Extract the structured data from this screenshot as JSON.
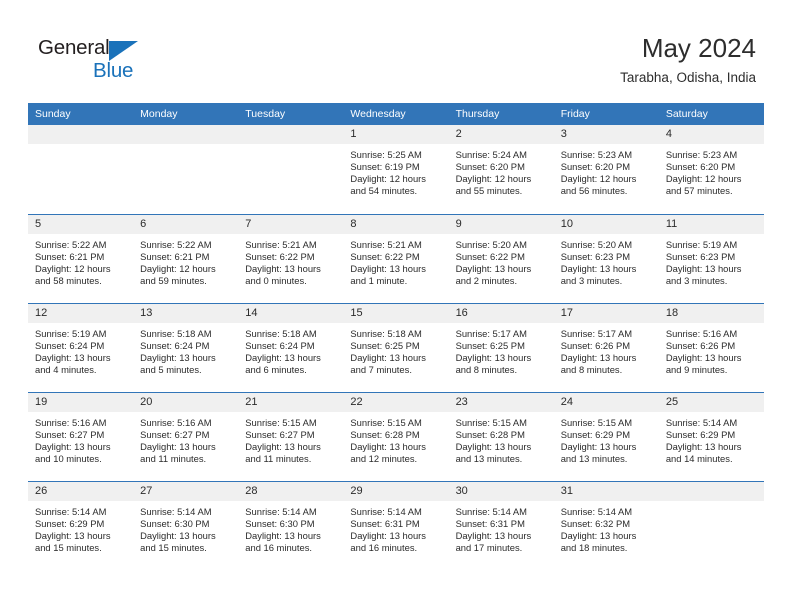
{
  "logo": {
    "text_general": "General",
    "text_blue": "Blue",
    "triangle_color": "#1a72ba"
  },
  "header": {
    "title": "May 2024",
    "subtitle": "Tarabha, Odisha, India"
  },
  "theme": {
    "header_blue": "#3275b8",
    "daynum_bg": "#f0f0f0",
    "text": "#2b2b2b"
  },
  "weekday_headers": [
    "Sunday",
    "Monday",
    "Tuesday",
    "Wednesday",
    "Thursday",
    "Friday",
    "Saturday"
  ],
  "labels": {
    "sunrise_prefix": "Sunrise: ",
    "sunset_prefix": "Sunset: ",
    "daylight_prefix": "Daylight: "
  },
  "weeks": [
    [
      {
        "day": "",
        "empty": true,
        "sunrise": "",
        "sunset": "",
        "daylight_line1": "",
        "daylight_line2": ""
      },
      {
        "day": "",
        "empty": true,
        "sunrise": "",
        "sunset": "",
        "daylight_line1": "",
        "daylight_line2": ""
      },
      {
        "day": "",
        "empty": true,
        "sunrise": "",
        "sunset": "",
        "daylight_line1": "",
        "daylight_line2": ""
      },
      {
        "day": "1",
        "empty": false,
        "sunrise": "Sunrise: 5:25 AM",
        "sunset": "Sunset: 6:19 PM",
        "daylight_line1": "Daylight: 12 hours",
        "daylight_line2": "and 54 minutes."
      },
      {
        "day": "2",
        "empty": false,
        "sunrise": "Sunrise: 5:24 AM",
        "sunset": "Sunset: 6:20 PM",
        "daylight_line1": "Daylight: 12 hours",
        "daylight_line2": "and 55 minutes."
      },
      {
        "day": "3",
        "empty": false,
        "sunrise": "Sunrise: 5:23 AM",
        "sunset": "Sunset: 6:20 PM",
        "daylight_line1": "Daylight: 12 hours",
        "daylight_line2": "and 56 minutes."
      },
      {
        "day": "4",
        "empty": false,
        "sunrise": "Sunrise: 5:23 AM",
        "sunset": "Sunset: 6:20 PM",
        "daylight_line1": "Daylight: 12 hours",
        "daylight_line2": "and 57 minutes."
      }
    ],
    [
      {
        "day": "5",
        "empty": false,
        "sunrise": "Sunrise: 5:22 AM",
        "sunset": "Sunset: 6:21 PM",
        "daylight_line1": "Daylight: 12 hours",
        "daylight_line2": "and 58 minutes."
      },
      {
        "day": "6",
        "empty": false,
        "sunrise": "Sunrise: 5:22 AM",
        "sunset": "Sunset: 6:21 PM",
        "daylight_line1": "Daylight: 12 hours",
        "daylight_line2": "and 59 minutes."
      },
      {
        "day": "7",
        "empty": false,
        "sunrise": "Sunrise: 5:21 AM",
        "sunset": "Sunset: 6:22 PM",
        "daylight_line1": "Daylight: 13 hours",
        "daylight_line2": "and 0 minutes."
      },
      {
        "day": "8",
        "empty": false,
        "sunrise": "Sunrise: 5:21 AM",
        "sunset": "Sunset: 6:22 PM",
        "daylight_line1": "Daylight: 13 hours",
        "daylight_line2": "and 1 minute."
      },
      {
        "day": "9",
        "empty": false,
        "sunrise": "Sunrise: 5:20 AM",
        "sunset": "Sunset: 6:22 PM",
        "daylight_line1": "Daylight: 13 hours",
        "daylight_line2": "and 2 minutes."
      },
      {
        "day": "10",
        "empty": false,
        "sunrise": "Sunrise: 5:20 AM",
        "sunset": "Sunset: 6:23 PM",
        "daylight_line1": "Daylight: 13 hours",
        "daylight_line2": "and 3 minutes."
      },
      {
        "day": "11",
        "empty": false,
        "sunrise": "Sunrise: 5:19 AM",
        "sunset": "Sunset: 6:23 PM",
        "daylight_line1": "Daylight: 13 hours",
        "daylight_line2": "and 3 minutes."
      }
    ],
    [
      {
        "day": "12",
        "empty": false,
        "sunrise": "Sunrise: 5:19 AM",
        "sunset": "Sunset: 6:24 PM",
        "daylight_line1": "Daylight: 13 hours",
        "daylight_line2": "and 4 minutes."
      },
      {
        "day": "13",
        "empty": false,
        "sunrise": "Sunrise: 5:18 AM",
        "sunset": "Sunset: 6:24 PM",
        "daylight_line1": "Daylight: 13 hours",
        "daylight_line2": "and 5 minutes."
      },
      {
        "day": "14",
        "empty": false,
        "sunrise": "Sunrise: 5:18 AM",
        "sunset": "Sunset: 6:24 PM",
        "daylight_line1": "Daylight: 13 hours",
        "daylight_line2": "and 6 minutes."
      },
      {
        "day": "15",
        "empty": false,
        "sunrise": "Sunrise: 5:18 AM",
        "sunset": "Sunset: 6:25 PM",
        "daylight_line1": "Daylight: 13 hours",
        "daylight_line2": "and 7 minutes."
      },
      {
        "day": "16",
        "empty": false,
        "sunrise": "Sunrise: 5:17 AM",
        "sunset": "Sunset: 6:25 PM",
        "daylight_line1": "Daylight: 13 hours",
        "daylight_line2": "and 8 minutes."
      },
      {
        "day": "17",
        "empty": false,
        "sunrise": "Sunrise: 5:17 AM",
        "sunset": "Sunset: 6:26 PM",
        "daylight_line1": "Daylight: 13 hours",
        "daylight_line2": "and 8 minutes."
      },
      {
        "day": "18",
        "empty": false,
        "sunrise": "Sunrise: 5:16 AM",
        "sunset": "Sunset: 6:26 PM",
        "daylight_line1": "Daylight: 13 hours",
        "daylight_line2": "and 9 minutes."
      }
    ],
    [
      {
        "day": "19",
        "empty": false,
        "sunrise": "Sunrise: 5:16 AM",
        "sunset": "Sunset: 6:27 PM",
        "daylight_line1": "Daylight: 13 hours",
        "daylight_line2": "and 10 minutes."
      },
      {
        "day": "20",
        "empty": false,
        "sunrise": "Sunrise: 5:16 AM",
        "sunset": "Sunset: 6:27 PM",
        "daylight_line1": "Daylight: 13 hours",
        "daylight_line2": "and 11 minutes."
      },
      {
        "day": "21",
        "empty": false,
        "sunrise": "Sunrise: 5:15 AM",
        "sunset": "Sunset: 6:27 PM",
        "daylight_line1": "Daylight: 13 hours",
        "daylight_line2": "and 11 minutes."
      },
      {
        "day": "22",
        "empty": false,
        "sunrise": "Sunrise: 5:15 AM",
        "sunset": "Sunset: 6:28 PM",
        "daylight_line1": "Daylight: 13 hours",
        "daylight_line2": "and 12 minutes."
      },
      {
        "day": "23",
        "empty": false,
        "sunrise": "Sunrise: 5:15 AM",
        "sunset": "Sunset: 6:28 PM",
        "daylight_line1": "Daylight: 13 hours",
        "daylight_line2": "and 13 minutes."
      },
      {
        "day": "24",
        "empty": false,
        "sunrise": "Sunrise: 5:15 AM",
        "sunset": "Sunset: 6:29 PM",
        "daylight_line1": "Daylight: 13 hours",
        "daylight_line2": "and 13 minutes."
      },
      {
        "day": "25",
        "empty": false,
        "sunrise": "Sunrise: 5:14 AM",
        "sunset": "Sunset: 6:29 PM",
        "daylight_line1": "Daylight: 13 hours",
        "daylight_line2": "and 14 minutes."
      }
    ],
    [
      {
        "day": "26",
        "empty": false,
        "sunrise": "Sunrise: 5:14 AM",
        "sunset": "Sunset: 6:29 PM",
        "daylight_line1": "Daylight: 13 hours",
        "daylight_line2": "and 15 minutes."
      },
      {
        "day": "27",
        "empty": false,
        "sunrise": "Sunrise: 5:14 AM",
        "sunset": "Sunset: 6:30 PM",
        "daylight_line1": "Daylight: 13 hours",
        "daylight_line2": "and 15 minutes."
      },
      {
        "day": "28",
        "empty": false,
        "sunrise": "Sunrise: 5:14 AM",
        "sunset": "Sunset: 6:30 PM",
        "daylight_line1": "Daylight: 13 hours",
        "daylight_line2": "and 16 minutes."
      },
      {
        "day": "29",
        "empty": false,
        "sunrise": "Sunrise: 5:14 AM",
        "sunset": "Sunset: 6:31 PM",
        "daylight_line1": "Daylight: 13 hours",
        "daylight_line2": "and 16 minutes."
      },
      {
        "day": "30",
        "empty": false,
        "sunrise": "Sunrise: 5:14 AM",
        "sunset": "Sunset: 6:31 PM",
        "daylight_line1": "Daylight: 13 hours",
        "daylight_line2": "and 17 minutes."
      },
      {
        "day": "31",
        "empty": false,
        "sunrise": "Sunrise: 5:14 AM",
        "sunset": "Sunset: 6:32 PM",
        "daylight_line1": "Daylight: 13 hours",
        "daylight_line2": "and 18 minutes."
      },
      {
        "day": "",
        "empty": true,
        "sunrise": "",
        "sunset": "",
        "daylight_line1": "",
        "daylight_line2": ""
      }
    ]
  ]
}
